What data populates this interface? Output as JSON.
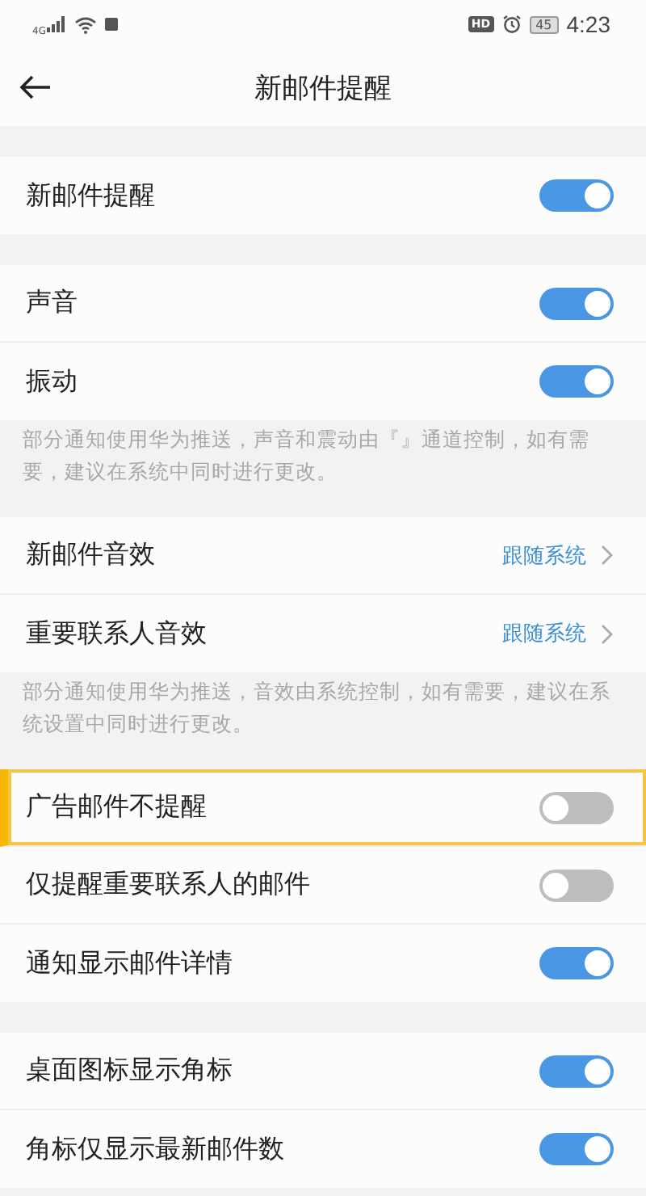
{
  "status_bar": {
    "network": "4G",
    "hd": "HD",
    "battery": "45",
    "time": "4:23"
  },
  "header": {
    "title": "新邮件提醒"
  },
  "sections": [
    {
      "rows": [
        {
          "kind": "toggle",
          "label": "新邮件提醒",
          "on": true
        }
      ]
    },
    {
      "rows": [
        {
          "kind": "toggle",
          "label": "声音",
          "on": true
        },
        {
          "kind": "toggle",
          "label": "振动",
          "on": true
        }
      ],
      "note": "部分通知使用华为推送，声音和震动由『』通道控制，如有需要，建议在系统中同时进行更改。"
    },
    {
      "rows": [
        {
          "kind": "link",
          "label": "新邮件音效",
          "value": "跟随系统"
        },
        {
          "kind": "link",
          "label": "重要联系人音效",
          "value": "跟随系统"
        }
      ],
      "note": "部分通知使用华为推送，音效由系统控制，如有需要，建议在系统设置中同时进行更改。"
    },
    {
      "rows": [
        {
          "kind": "toggle",
          "label": "广告邮件不提醒",
          "on": false,
          "highlighted": true
        },
        {
          "kind": "toggle",
          "label": "仅提醒重要联系人的邮件",
          "on": false
        },
        {
          "kind": "toggle",
          "label": "通知显示邮件详情",
          "on": true
        }
      ]
    },
    {
      "rows": [
        {
          "kind": "toggle",
          "label": "桌面图标显示角标",
          "on": true
        },
        {
          "kind": "toggle",
          "label": "角标仅显示最新邮件数",
          "on": true
        }
      ]
    }
  ]
}
